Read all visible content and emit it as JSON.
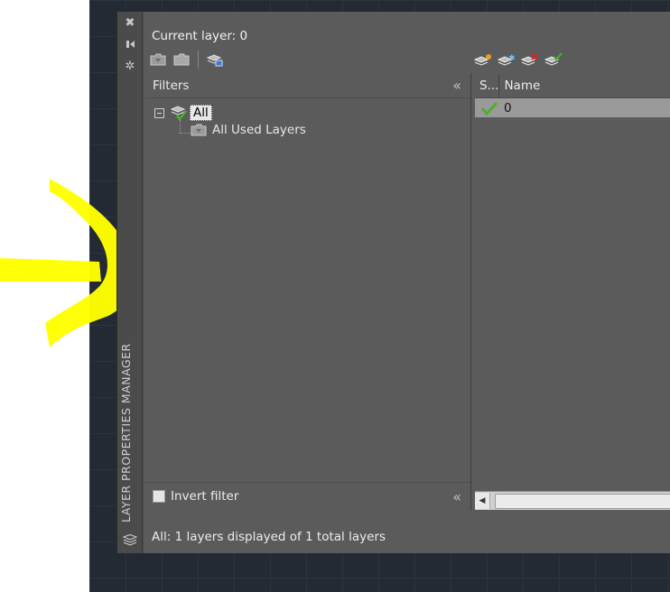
{
  "panel": {
    "title": "LAYER PROPERTIES MANAGER",
    "current_layer": "Current layer: 0",
    "status": "All: 1 layers displayed of 1 total layers"
  },
  "filters": {
    "header": "Filters",
    "tree": [
      {
        "label": "All",
        "selected": true
      },
      {
        "label": "All Used Layers",
        "selected": false
      }
    ],
    "invert_label": "Invert filter"
  },
  "layers": {
    "columns": [
      "S...",
      "Name"
    ],
    "rows": [
      {
        "status": "current-check",
        "name": "0"
      }
    ]
  },
  "colors": {
    "panel_bg": "#5b5b5b",
    "selected_row": "#9a9a9a",
    "annotation": "#ffff00",
    "check_green": "#4caf2a"
  }
}
